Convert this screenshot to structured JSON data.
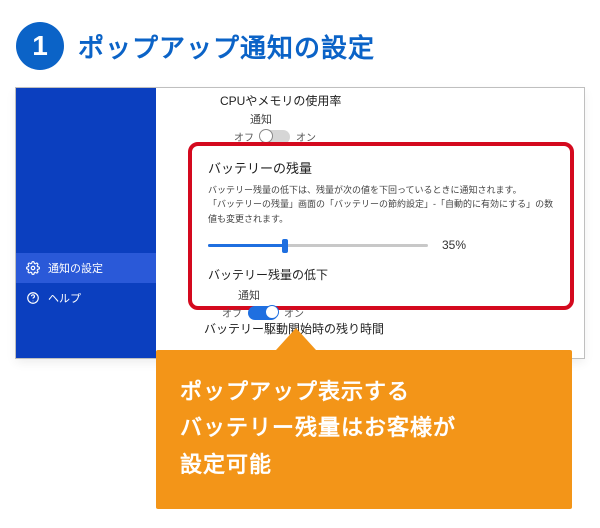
{
  "step": {
    "number": "1",
    "title": "ポップアップ通知の設定"
  },
  "sidebar": {
    "items": [
      {
        "label": "通知の設定",
        "icon": "gear",
        "active": true
      },
      {
        "label": "ヘルプ",
        "icon": "help",
        "active": false
      }
    ]
  },
  "content": {
    "cpu": {
      "title": "CPUやメモリの使用率",
      "notif_label": "通知",
      "toggle_off_label": "オフ",
      "toggle_on_label": "オン",
      "toggle_state": "off"
    },
    "battery": {
      "title": "バッテリーの残量",
      "desc_line1": "バッテリー残量の低下は、残量が次の値を下回っているときに通知されます。",
      "desc_line2": "「バッテリーの残量」画面の「バッテリーの節約設定」-「自動的に有効にする」の数値も変更されます。",
      "slider_percent": 35,
      "slider_display": "35%",
      "sub_title": "バッテリー残量の低下",
      "sub_notif_label": "通知",
      "sub_toggle_off_label": "オフ",
      "sub_toggle_on_label": "オン",
      "sub_toggle_state": "on"
    },
    "boot": {
      "title": "バッテリー駆動開始時の残り時間"
    }
  },
  "callout": {
    "line1": "ポップアップ表示する",
    "line2": "バッテリー残量はお客様が",
    "line3": "設定可能"
  }
}
